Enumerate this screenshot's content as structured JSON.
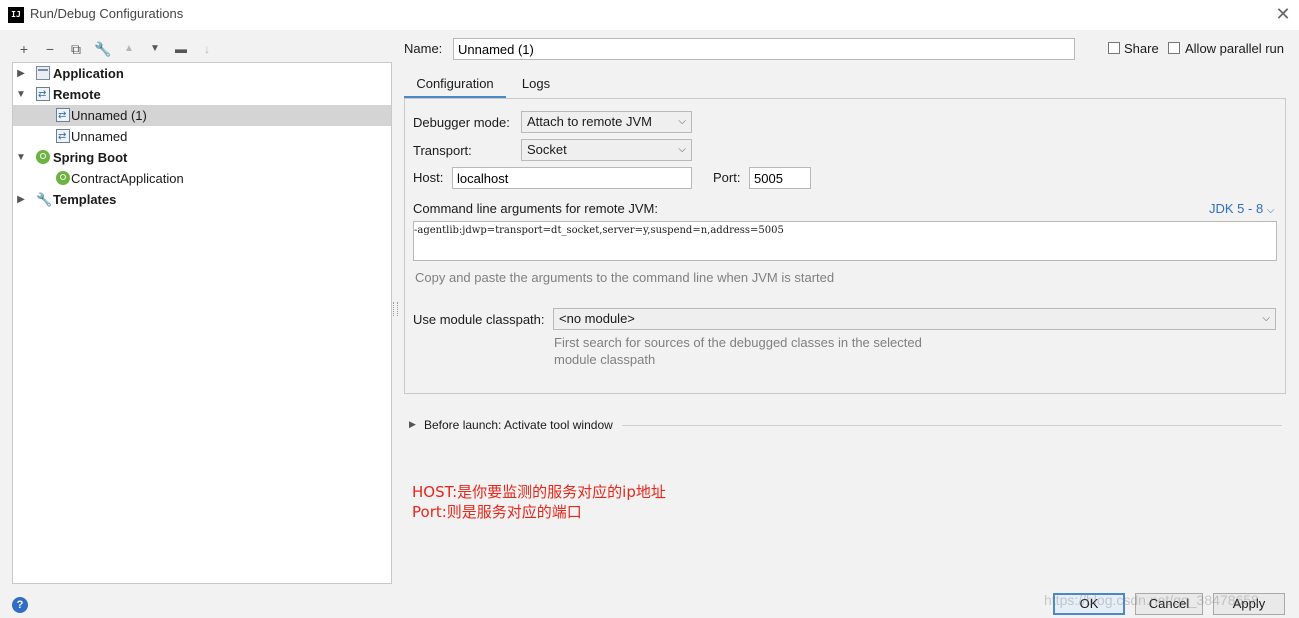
{
  "window": {
    "title": "Run/Debug Configurations",
    "logo_text": "IJ"
  },
  "toolbar": {
    "icons": [
      "add-icon",
      "remove-icon",
      "copy-icon",
      "wrench-icon",
      "move-up-icon",
      "move-down-icon",
      "new-folder-icon",
      "sort-icon"
    ]
  },
  "tree": {
    "items": [
      {
        "label": "Application",
        "icon": "application-icon",
        "expanded": false
      },
      {
        "label": "Remote",
        "icon": "remote-icon",
        "expanded": true
      },
      {
        "label": "Unnamed (1)",
        "icon": "remote-config-icon",
        "selected": true
      },
      {
        "label": "Unnamed",
        "icon": "remote-config-icon"
      },
      {
        "label": "Spring Boot",
        "icon": "spring-boot-icon",
        "expanded": true
      },
      {
        "label": "ContractApplication",
        "icon": "spring-boot-icon"
      },
      {
        "label": "Templates",
        "icon": "wrench-icon",
        "expanded": false
      }
    ]
  },
  "header": {
    "name_label": "Name:",
    "name_value": "Unnamed (1)",
    "share_label": "Share",
    "share_checked": false,
    "parallel_label": "Allow parallel run",
    "parallel_checked": false
  },
  "tabs": [
    {
      "label": "Configuration",
      "active": true
    },
    {
      "label": "Logs",
      "active": false
    }
  ],
  "config": {
    "debugger_mode_label": "Debugger mode:",
    "debugger_mode_value": "Attach to remote JVM",
    "transport_label": "Transport:",
    "transport_value": "Socket",
    "host_label": "Host:",
    "host_value": "localhost",
    "port_label": "Port:",
    "port_value": "5005",
    "cmd_label": "Command line arguments for remote JVM:",
    "jdk_link": "JDK 5 - 8",
    "cmd_value": "-agentlib:jdwp=transport=dt_socket,server=y,suspend=n,address=5005",
    "cmd_hint": "Copy and paste the arguments to the command line when JVM is started",
    "module_label": "Use module classpath:",
    "module_value": "<no module>",
    "module_hint_1": "First search for sources of the debugged classes in the selected",
    "module_hint_2": "module classpath"
  },
  "before_launch": {
    "label": "Before launch: Activate tool window"
  },
  "annotation": {
    "line1": "HOST:是你要监测的服务对应的ip地址",
    "line2": "Port:则是服务对应的端口"
  },
  "buttons": {
    "ok": "OK",
    "cancel": "Cancel",
    "apply": "Apply"
  },
  "watermark": "https://blog.csdn.net/qq_38478658",
  "colors": {
    "accent": "#4a88c7",
    "link": "#2f6ec4",
    "annotation": "#e8261a",
    "selection": "#d4d4d4"
  }
}
